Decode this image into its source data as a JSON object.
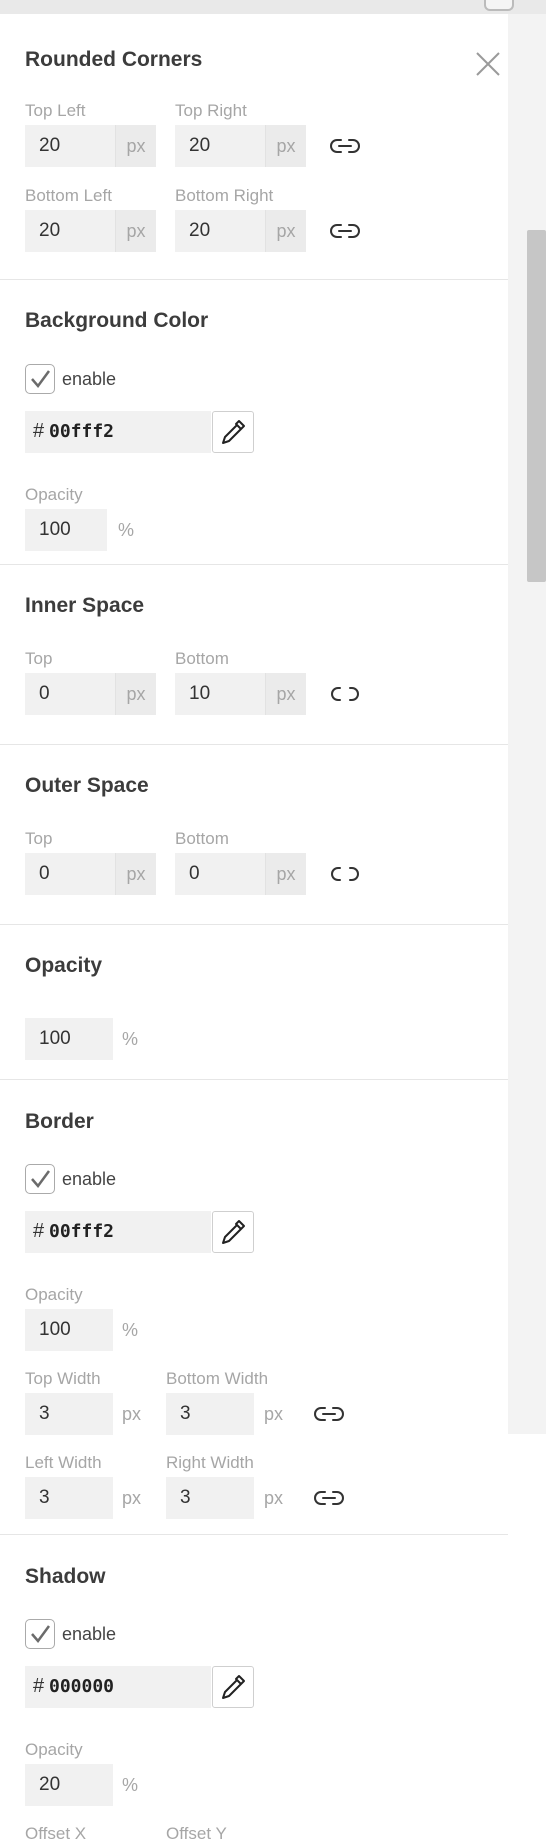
{
  "rounded": {
    "title": "Rounded Corners",
    "top_left_label": "Top Left",
    "top_left": "20",
    "top_right_label": "Top Right",
    "top_right": "20",
    "bottom_left_label": "Bottom Left",
    "bottom_left": "20",
    "bottom_right_label": "Bottom Right",
    "bottom_right": "20",
    "unit": "px"
  },
  "background": {
    "title": "Background Color",
    "enable_label": "enable",
    "enabled": true,
    "hash": "#",
    "hex": "00fff2",
    "opacity_label": "Opacity",
    "opacity": "100",
    "pct": "%"
  },
  "inner_space": {
    "title": "Inner Space",
    "top_label": "Top",
    "top": "0",
    "bottom_label": "Bottom",
    "bottom": "10",
    "unit": "px"
  },
  "outer_space": {
    "title": "Outer Space",
    "top_label": "Top",
    "top": "0",
    "bottom_label": "Bottom",
    "bottom": "0",
    "unit": "px"
  },
  "opacity": {
    "title": "Opacity",
    "value": "100",
    "pct": "%"
  },
  "border": {
    "title": "Border",
    "enable_label": "enable",
    "enabled": true,
    "hash": "#",
    "hex": "00fff2",
    "opacity_label": "Opacity",
    "opacity": "100",
    "pct": "%",
    "top_width_label": "Top Width",
    "top_width": "3",
    "bottom_width_label": "Bottom Width",
    "bottom_width": "3",
    "left_width_label": "Left Width",
    "left_width": "3",
    "right_width_label": "Right Width",
    "right_width": "3",
    "unit": "px"
  },
  "shadow": {
    "title": "Shadow",
    "enable_label": "enable",
    "enabled": true,
    "hash": "#",
    "hex": "000000",
    "opacity_label": "Opacity",
    "opacity": "20",
    "pct": "%",
    "offset_x_label": "Offset X",
    "offset_y_label": "Offset Y"
  },
  "icons": {
    "close": "close-icon",
    "link": "link-icon",
    "unlink": "unlink-icon",
    "eyedropper": "eyedropper-icon",
    "checkmark": "checkmark-icon"
  },
  "colors": {
    "check": "#6b6b6b",
    "input_bg": "#f1f1f1",
    "label": "#a6a6a6"
  }
}
